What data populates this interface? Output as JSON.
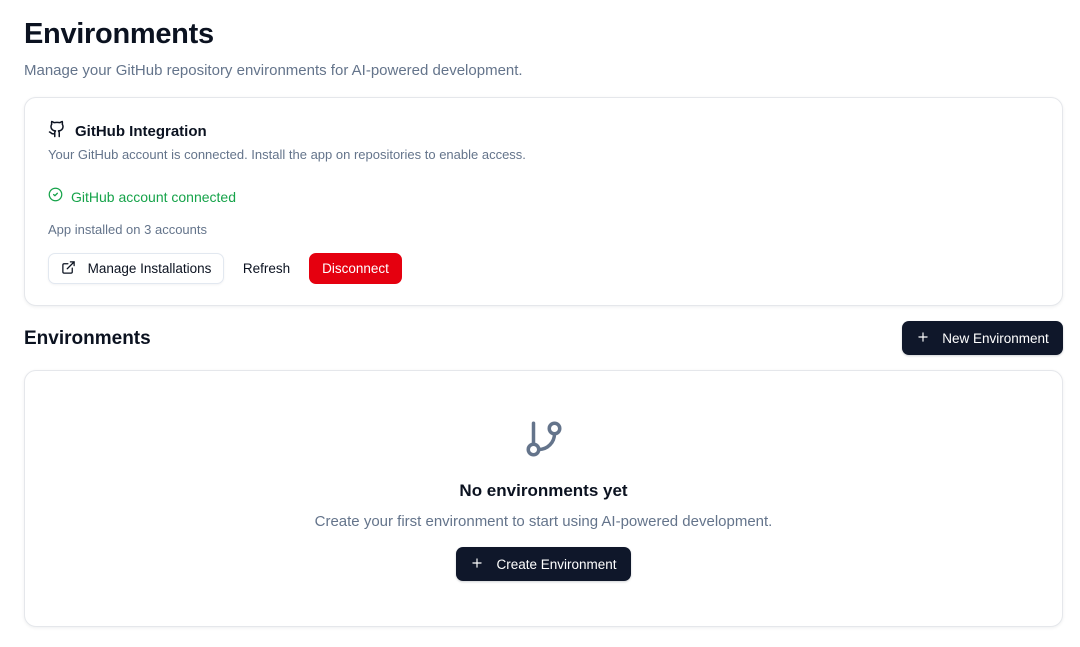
{
  "header": {
    "title": "Environments",
    "subtitle": "Manage your GitHub repository environments for AI-powered development."
  },
  "github_card": {
    "icon": "github-icon",
    "title": "GitHub Integration",
    "description": "Your GitHub account is connected. Install the app on repositories to enable access.",
    "status_icon": "check-circle-icon",
    "status_text": "GitHub account connected",
    "status_color": "#16a34a",
    "install_info": "App installed on 3 accounts",
    "buttons": {
      "manage_icon": "external-link-icon",
      "manage_label": "Manage Installations",
      "refresh_label": "Refresh",
      "disconnect_label": "Disconnect",
      "disconnect_color": "#e5000f"
    }
  },
  "environments": {
    "section_title": "Environments",
    "new_button_icon": "plus-icon",
    "new_button_label": "New Environment",
    "empty_state": {
      "icon": "git-branch-icon",
      "title": "No environments yet",
      "description": "Create your first environment to start using AI-powered development.",
      "button_icon": "plus-icon",
      "button_label": "Create Environment"
    }
  },
  "colors": {
    "primary_dark": "#0f172a",
    "muted_text": "#64748b",
    "border": "#e5e7eb"
  }
}
